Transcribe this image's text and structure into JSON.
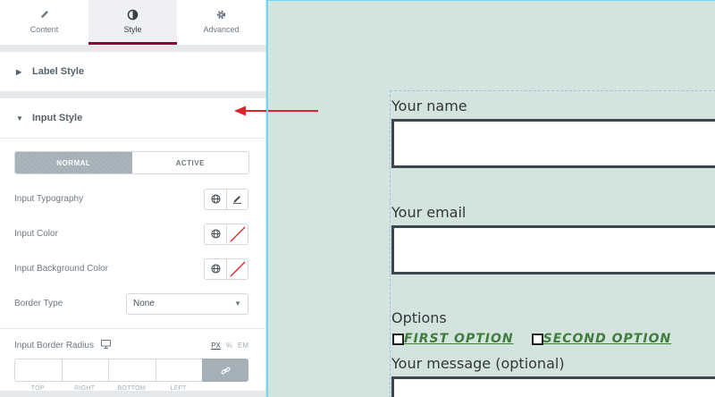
{
  "tabs": [
    {
      "label": "Content",
      "icon": "pencil-icon"
    },
    {
      "label": "Style",
      "icon": "half-circle-icon"
    },
    {
      "label": "Advanced",
      "icon": "gear-icon"
    }
  ],
  "sections": {
    "label_style": "Label Style",
    "input_style": "Input Style"
  },
  "state_switcher": {
    "normal": "NORMAL",
    "active": "ACTIVE"
  },
  "controls": {
    "typography": "Input Typography",
    "color": "Input Color",
    "background": "Input Background Color",
    "border_type": "Border Type",
    "border_type_value": "None",
    "border_radius": "Input Border Radius"
  },
  "units": [
    "PX",
    "%",
    "EM"
  ],
  "dimension_labels": [
    "TOP",
    "RIGHT",
    "BOTTOM",
    "LEFT"
  ],
  "preview": {
    "name_label": "Your name",
    "email_label": "Your email",
    "options_label": "Options",
    "option1": "FIRST OPTION",
    "option2": "SECOND OPTION",
    "message_label": "Your message (optional)"
  },
  "colors": {
    "accent": "#93003c",
    "preview_bg": "#d3e3dd",
    "option_text": "#3e7d3c",
    "annotation_arrow": "#e0202a"
  }
}
